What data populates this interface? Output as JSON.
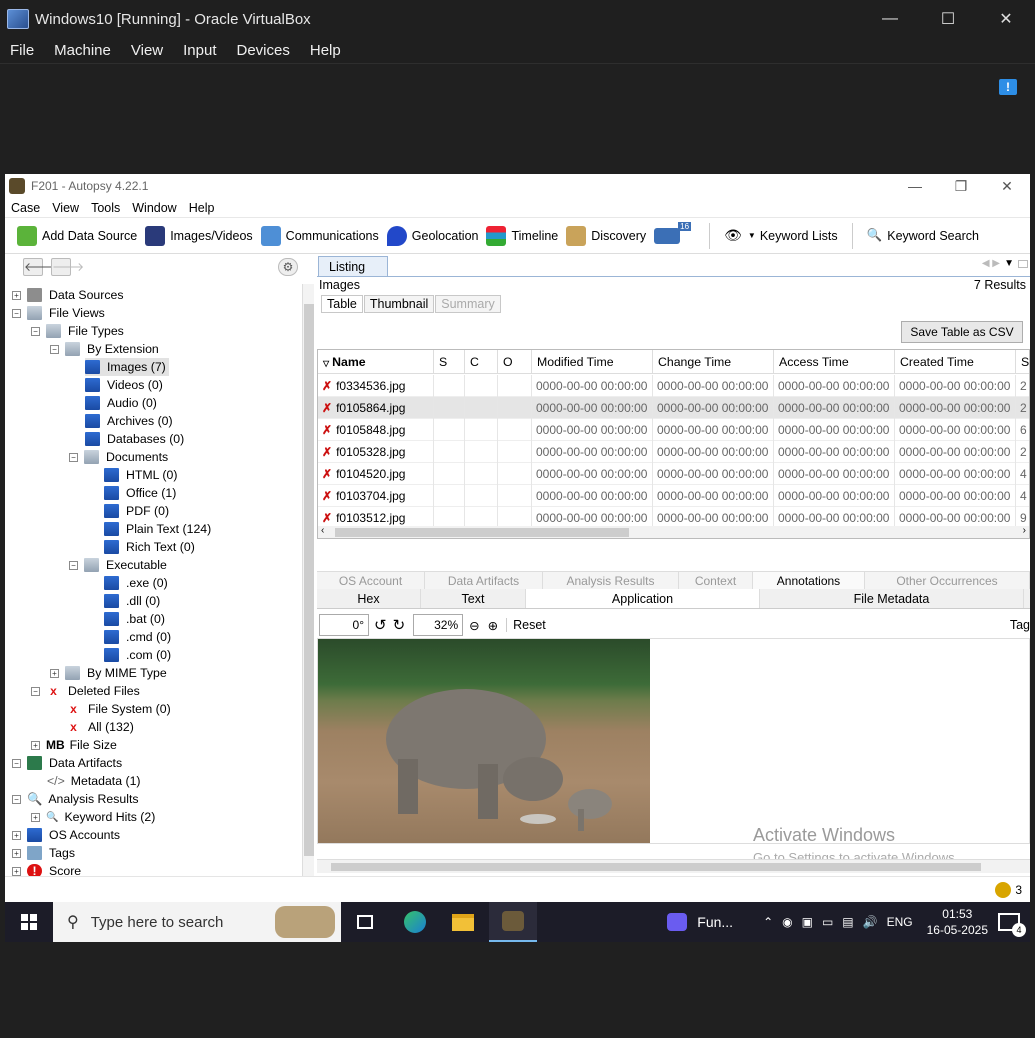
{
  "vbox": {
    "title": "Windows10 [Running] - Oracle VirtualBox",
    "menu": [
      "File",
      "Machine",
      "View",
      "Input",
      "Devices",
      "Help"
    ],
    "notify_icon": "!"
  },
  "autopsy": {
    "title": "F201 - Autopsy 4.22.1",
    "menu": [
      "Case",
      "View",
      "Tools",
      "Window",
      "Help"
    ],
    "toolbar": {
      "add_data_source": "Add Data Source",
      "images_videos": "Images/Videos",
      "communications": "Communications",
      "geolocation": "Geolocation",
      "timeline": "Timeline",
      "discovery": "Discovery",
      "mail_badge": "16",
      "keyword_lists": "Keyword Lists",
      "keyword_search": "Keyword Search"
    },
    "tree": {
      "data_sources": "Data Sources",
      "file_views": "File Views",
      "file_types": "File Types",
      "by_extension": "By Extension",
      "images": "Images (7)",
      "videos": "Videos (0)",
      "audio": "Audio (0)",
      "archives": "Archives (0)",
      "databases": "Databases (0)",
      "documents": "Documents",
      "html": "HTML (0)",
      "office": "Office (1)",
      "pdf": "PDF (0)",
      "plain_text": "Plain Text (124)",
      "rich_text": "Rich Text (0)",
      "executable": "Executable",
      "exe": ".exe (0)",
      "dll": ".dll (0)",
      "bat": ".bat (0)",
      "cmd": ".cmd (0)",
      "com": ".com (0)",
      "by_mime": "By MIME Type",
      "deleted_files": "Deleted Files",
      "file_system": "File System (0)",
      "all": "All (132)",
      "mb_prefix": "MB",
      "file_size": "File Size",
      "data_artifacts": "Data Artifacts",
      "metadata": "Metadata (1)",
      "analysis_results": "Analysis Results",
      "keyword_hits": "Keyword Hits (2)",
      "os_accounts": "OS Accounts",
      "tags": "Tags",
      "score": "Score"
    },
    "listing": {
      "tab": "Listing",
      "heading": "Images",
      "results": "7  Results",
      "subtabs": [
        "Table",
        "Thumbnail",
        "Summary"
      ],
      "save_csv": "Save Table as CSV",
      "columns": [
        "Name",
        "S",
        "C",
        "O",
        "Modified Time",
        "Change Time",
        "Access Time",
        "Created Time",
        "S"
      ],
      "rows": [
        {
          "name": "f0334536.jpg",
          "mtime": "0000-00-00 00:00:00",
          "ctime": "0000-00-00 00:00:00",
          "atime": "0000-00-00 00:00:00",
          "crtime": "0000-00-00 00:00:00",
          "size": "2"
        },
        {
          "name": "f0105864.jpg",
          "mtime": "0000-00-00 00:00:00",
          "ctime": "0000-00-00 00:00:00",
          "atime": "0000-00-00 00:00:00",
          "crtime": "0000-00-00 00:00:00",
          "size": "2"
        },
        {
          "name": "f0105848.jpg",
          "mtime": "0000-00-00 00:00:00",
          "ctime": "0000-00-00 00:00:00",
          "atime": "0000-00-00 00:00:00",
          "crtime": "0000-00-00 00:00:00",
          "size": "6"
        },
        {
          "name": "f0105328.jpg",
          "mtime": "0000-00-00 00:00:00",
          "ctime": "0000-00-00 00:00:00",
          "atime": "0000-00-00 00:00:00",
          "crtime": "0000-00-00 00:00:00",
          "size": "2"
        },
        {
          "name": "f0104520.jpg",
          "mtime": "0000-00-00 00:00:00",
          "ctime": "0000-00-00 00:00:00",
          "atime": "0000-00-00 00:00:00",
          "crtime": "0000-00-00 00:00:00",
          "size": "4"
        },
        {
          "name": "f0103704.jpg",
          "mtime": "0000-00-00 00:00:00",
          "ctime": "0000-00-00 00:00:00",
          "atime": "0000-00-00 00:00:00",
          "crtime": "0000-00-00 00:00:00",
          "size": "4"
        },
        {
          "name": "f0103512.jpg",
          "mtime": "0000-00-00 00:00:00",
          "ctime": "0000-00-00 00:00:00",
          "atime": "0000-00-00 00:00:00",
          "crtime": "0000-00-00 00:00:00",
          "size": "9"
        }
      ]
    },
    "viewer": {
      "tabs_top": [
        "OS Account",
        "Data Artifacts",
        "Analysis Results",
        "Context",
        "Annotations",
        "Other Occurrences"
      ],
      "tabs_bottom": [
        "Hex",
        "Text",
        "Application",
        "File Metadata"
      ],
      "rotation": "0°",
      "zoom": "32%",
      "reset": "Reset",
      "tag": "Tag",
      "watermark_title": "Activate Windows",
      "watermark_sub": "Go to Settings to activate Windows."
    },
    "status_count": "3"
  },
  "taskbar": {
    "search_placeholder": "Type here to search",
    "running_app": "Fun...",
    "lang": "ENG",
    "time": "01:53",
    "date": "16-05-2025",
    "notif_count": "4"
  }
}
